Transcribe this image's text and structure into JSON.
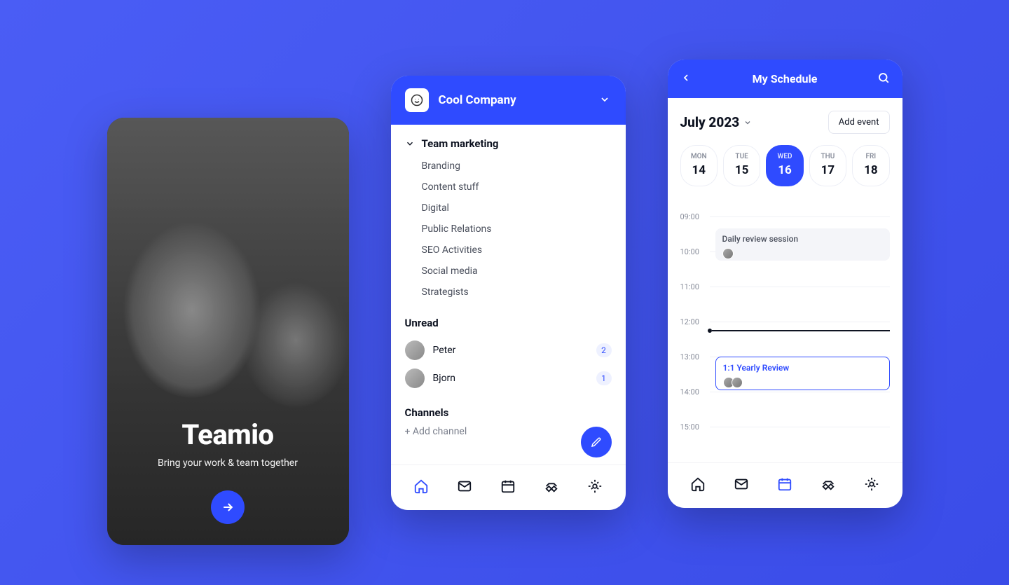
{
  "onboard": {
    "title": "Teamio",
    "subtitle": "Bring your work & team together"
  },
  "channels": {
    "company": "Cool Company",
    "group_title": "Team marketing",
    "group_items": [
      "Branding",
      "Content stuff",
      "Digital",
      "Public Relations",
      "SEO Activities",
      "Social media",
      "Strategists"
    ],
    "unread_title": "Unread",
    "unread": [
      {
        "name": "Peter",
        "count": "2"
      },
      {
        "name": "Bjorn",
        "count": "1"
      }
    ],
    "channels_title": "Channels",
    "add_channel": "+ Add channel"
  },
  "schedule": {
    "title": "My Schedule",
    "month": "July 2023",
    "add_event": "Add event",
    "days": [
      {
        "dow": "MON",
        "num": "14"
      },
      {
        "dow": "TUE",
        "num": "15"
      },
      {
        "dow": "WED",
        "num": "16"
      },
      {
        "dow": "THU",
        "num": "17"
      },
      {
        "dow": "FRI",
        "num": "18"
      }
    ],
    "active_day_index": 2,
    "hours": [
      "09:00",
      "10:00",
      "11:00",
      "12:00",
      "13:00",
      "14:00",
      "15:00"
    ],
    "events": {
      "e1": "Daily review session",
      "e2": "1:1 Yearly Review"
    }
  }
}
